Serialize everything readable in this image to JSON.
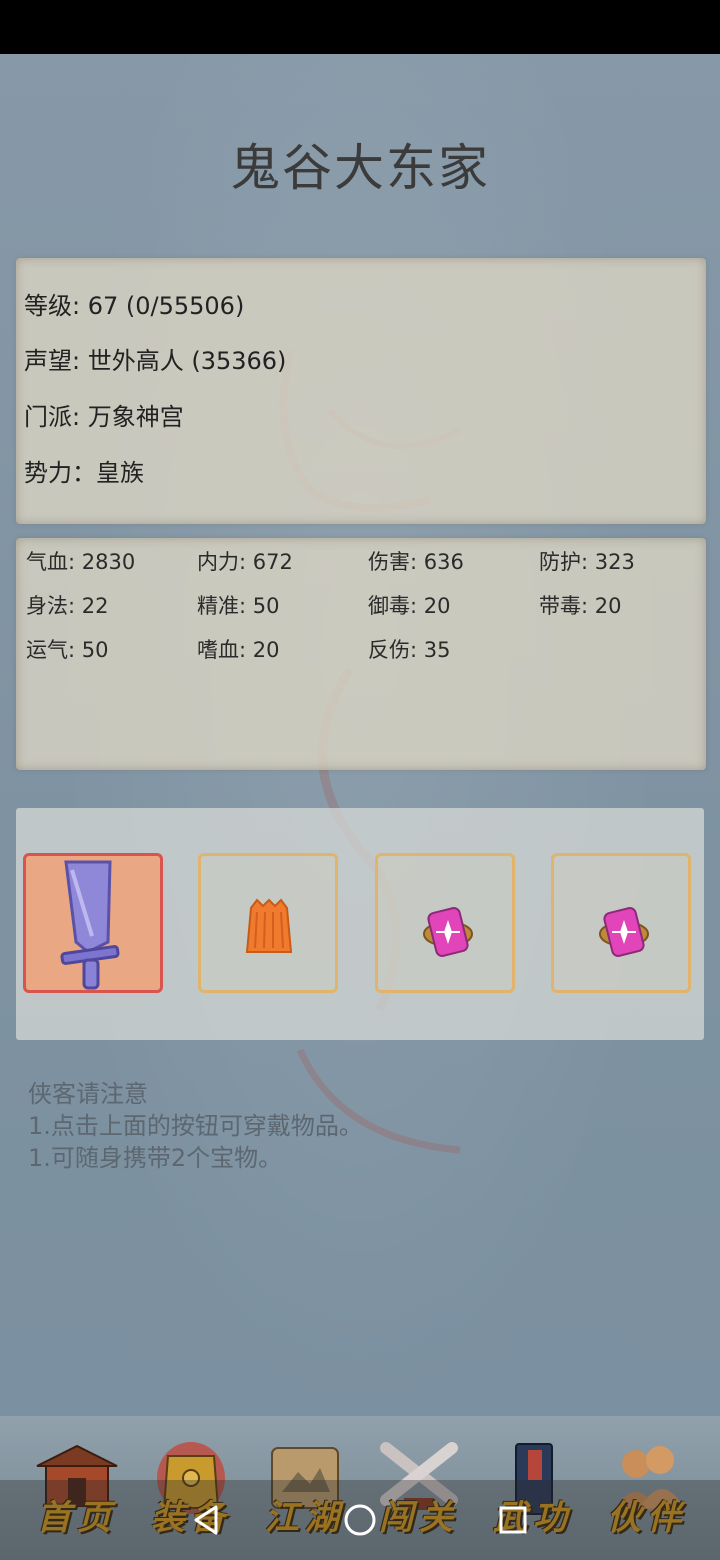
{
  "title": "鬼谷大东家",
  "info": {
    "level": "等级: 67 (0/55506)",
    "reputation": "声望: 世外高人 (35366)",
    "sect": "门派: 万象神宫",
    "faction": "势力：皇族"
  },
  "stats": [
    [
      "气血: 2830",
      "内力: 672",
      "伤害: 636",
      "防护: 323"
    ],
    [
      "身法: 22",
      "精准: 50",
      "御毒: 20",
      "带毒: 20"
    ],
    [
      "运气: 50",
      "嗜血: 20",
      "反伤: 35"
    ]
  ],
  "equipment": [
    {
      "icon": "sword-icon",
      "selected": true
    },
    {
      "icon": "armor-icon",
      "selected": false
    },
    {
      "icon": "gem-token-icon",
      "selected": false
    },
    {
      "icon": "gem-token-icon",
      "selected": false
    }
  ],
  "notes": {
    "heading": "侠客请注意",
    "line1": "1.点击上面的按钮可穿戴物品。",
    "line2": "1.可随身携带2个宝物。"
  },
  "nav": [
    {
      "label": "首页",
      "icon": "house-icon"
    },
    {
      "label": "装备",
      "icon": "armor-icon"
    },
    {
      "label": "江湖",
      "icon": "scroll-map-icon"
    },
    {
      "label": "闯关",
      "icon": "crossed-swords-icon"
    },
    {
      "label": "武功",
      "icon": "book-icon"
    },
    {
      "label": "伙伴",
      "icon": "people-icon"
    }
  ],
  "colors": {
    "accent_gold": "#d69b1e",
    "slot_border": "#e1b46d",
    "selected_border": "#d9544e"
  }
}
